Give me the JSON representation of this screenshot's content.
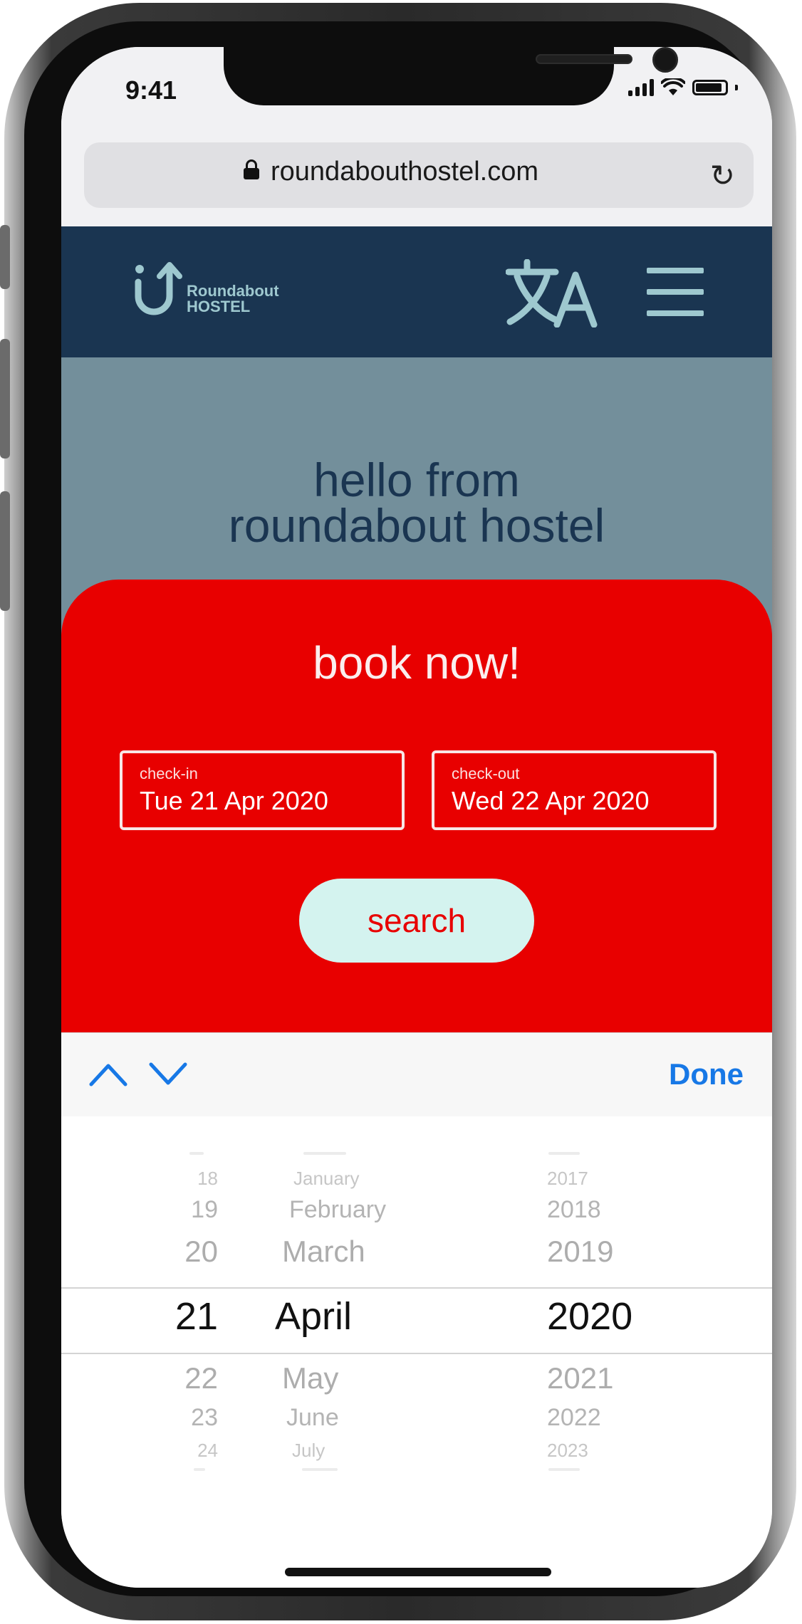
{
  "status_bar": {
    "time": "9:41"
  },
  "browser": {
    "url": "roundabouthostel.com",
    "lock_icon": "lock-icon",
    "reload_icon": "reload-icon"
  },
  "site_header": {
    "logo_line1": "Roundabout",
    "logo_line2": "HOSTEL",
    "language_icon": "translate-icon",
    "menu_icon": "hamburger-menu-icon"
  },
  "hero": {
    "title_line1": "hello from",
    "title_line2": "roundabout hostel"
  },
  "booking": {
    "title": "book now!",
    "checkin_label": "check-in",
    "checkin_value": "Tue 21 Apr 2020",
    "checkout_label": "check-out",
    "checkout_value": "Wed 22 Apr 2020",
    "search_label": "search"
  },
  "picker_toolbar": {
    "done_label": "Done"
  },
  "picker": {
    "days": [
      "18",
      "19",
      "20",
      "21",
      "22",
      "23",
      "24"
    ],
    "months": [
      "January",
      "February",
      "March",
      "April",
      "May",
      "June",
      "July"
    ],
    "years": [
      "2017",
      "2018",
      "2019",
      "2020",
      "2021",
      "2022",
      "2023"
    ],
    "selected": {
      "day": "21",
      "month": "April",
      "year": "2020"
    }
  },
  "colors": {
    "header_bg": "#1a3551",
    "hero_bg": "#738f9b",
    "booking_bg": "#e80000",
    "search_bg": "#d4f3ef",
    "accent_blue": "#1778e6",
    "logo_teal": "#9ec8cf"
  }
}
